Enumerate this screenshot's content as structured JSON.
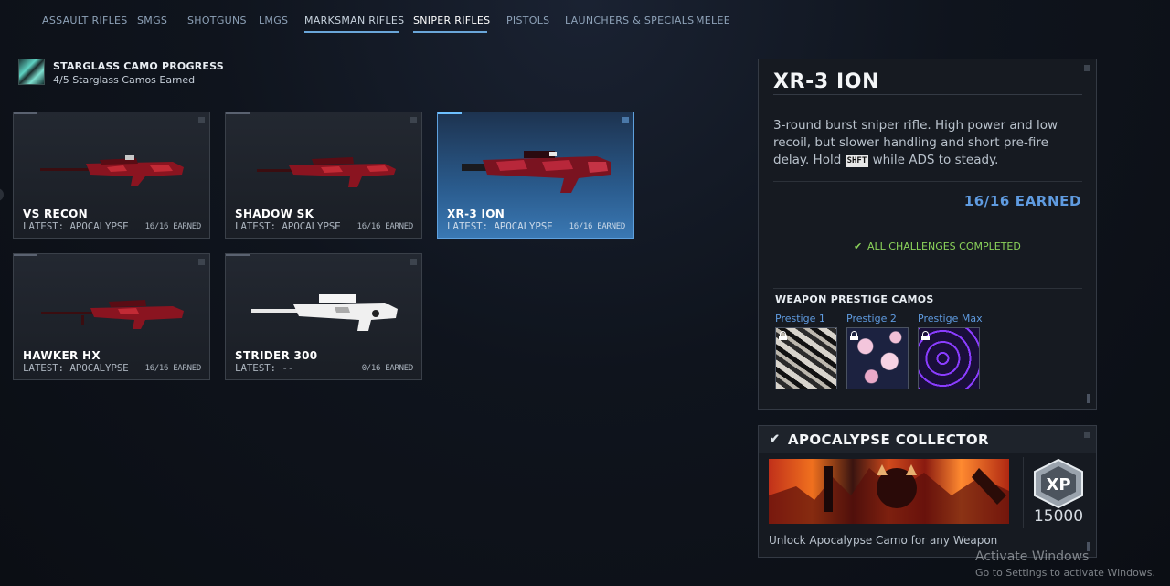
{
  "tabs": [
    {
      "label": "ASSAULT RIFLES"
    },
    {
      "label": "SMGS"
    },
    {
      "label": "SHOTGUNS"
    },
    {
      "label": "LMGS"
    },
    {
      "label": "MARKSMAN RIFLES"
    },
    {
      "label": "SNIPER RIFLES"
    },
    {
      "label": "PISTOLS"
    },
    {
      "label": "LAUNCHERS & SPECIALS"
    },
    {
      "label": "MELEE"
    }
  ],
  "active_tab": "SNIPER RIFLES",
  "progress": {
    "icon": "starglass-camo-icon",
    "title": "STARGLASS CAMO PROGRESS",
    "subtitle": "4/5 Starglass Camos Earned"
  },
  "weapons": [
    {
      "name": "VS RECON",
      "latest": "LATEST: APOCALYPSE",
      "earned": "16/16 EARNED",
      "camo": "red",
      "selected": false
    },
    {
      "name": "SHADOW SK",
      "latest": "LATEST: APOCALYPSE",
      "earned": "16/16 EARNED",
      "camo": "red",
      "selected": false
    },
    {
      "name": "XR-3 ION",
      "latest": "LATEST: APOCALYPSE",
      "earned": "16/16 EARNED",
      "camo": "red",
      "selected": true
    },
    {
      "name": "HAWKER HX",
      "latest": "LATEST: APOCALYPSE",
      "earned": "16/16 EARNED",
      "camo": "red",
      "selected": false
    },
    {
      "name": "STRIDER 300",
      "latest": "LATEST: --",
      "earned": "0/16 EARNED",
      "camo": "white",
      "selected": false
    }
  ],
  "detail": {
    "title": "XR-3 ION",
    "desc_part1": "3-round burst sniper rifle. High power and low recoil, but slower handling and short pre-fire delay. Hold",
    "key": "SHFT",
    "desc_part2": "while ADS to steady.",
    "earned": "16/16 EARNED",
    "status": "ALL CHALLENGES COMPLETED",
    "prestige_heading": "WEAPON PRESTIGE CAMOS",
    "prestige": [
      {
        "label": "Prestige 1",
        "icon": "lock-icon"
      },
      {
        "label": "Prestige 2",
        "icon": "lock-icon"
      },
      {
        "label": "Prestige Max",
        "icon": "lock-icon"
      }
    ]
  },
  "collector": {
    "title": "APOCALYPSE COLLECTOR",
    "xp_badge": "XP",
    "xp_amount": "15000",
    "description": "Unlock Apocalypse Camo for any Weapon"
  },
  "watermark": {
    "title": "Activate Windows",
    "subtitle": "Go to Settings to activate Windows."
  },
  "colors": {
    "accent_blue": "#5f9be0",
    "complete_green": "#8bd35a",
    "selected_card": "#3a78b3"
  }
}
